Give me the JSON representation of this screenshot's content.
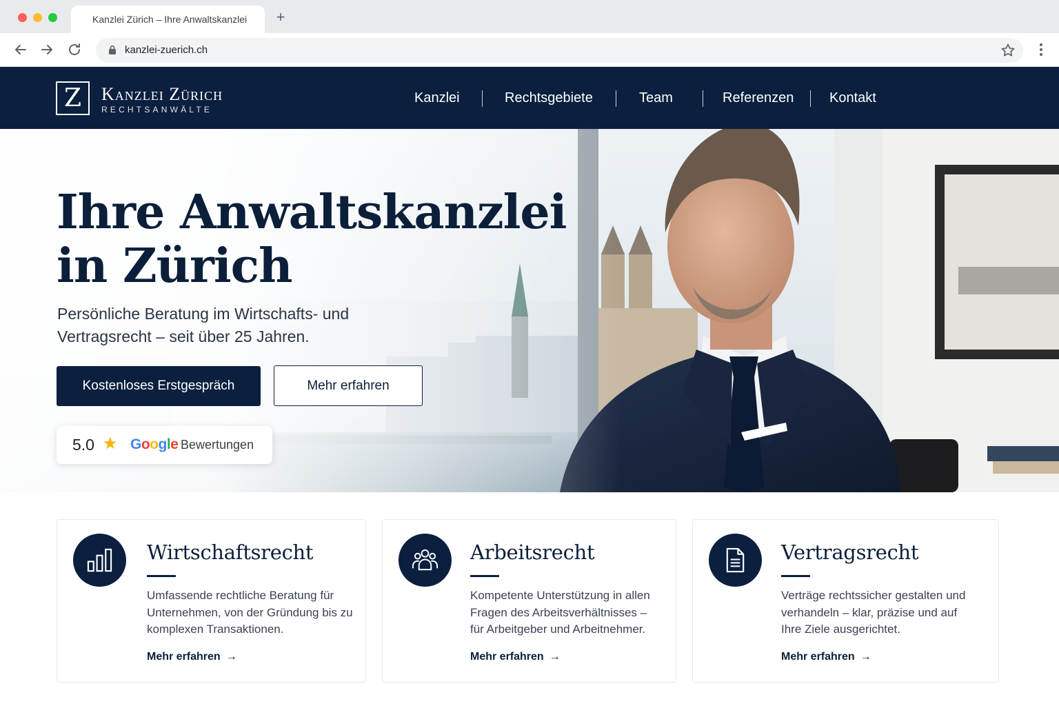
{
  "browser": {
    "tab_title": "Kanzlei Zürich – Ihre Anwaltskanzlei",
    "new_tab_icon": "plus-icon",
    "url": "kanzlei-zuerich.ch"
  },
  "site": {
    "logo_letter": "Z",
    "logo_name": "Kanzlei Zürich",
    "logo_tagline": "RECHTSANWÄLTE",
    "nav": [
      {
        "label": "Kanzlei"
      },
      {
        "label": "Rechtsgebiete"
      },
      {
        "label": "Team"
      },
      {
        "label": "Referenzen"
      },
      {
        "label": "Kontakt"
      }
    ]
  },
  "hero": {
    "title_line1": "Ihre Anwaltskanzlei",
    "title_line2": "in Zürich",
    "subtitle": "Persönliche Beratung im Wirtschafts- und Vertragsrecht – seit über 25 Jahren.",
    "primary_button": "Kostenloses Erstgespräch",
    "secondary_button": "Mehr erfahren",
    "rating": {
      "score": "5.0",
      "provider": "Google",
      "label": "Bewertungen"
    }
  },
  "cards": [
    {
      "icon": "bar-chart-icon",
      "title": "Wirtschaftsrecht",
      "text": "Umfassende rechtliche Beratung für Unternehmen, von der Gründung bis zu komplexen Transaktionen.",
      "link": "Mehr erfahren"
    },
    {
      "icon": "people-group-icon",
      "title": "Arbeitsrecht",
      "text": "Kompetente Unterstützung in allen Fragen des Arbeitsverhältnisses – für Arbeitgeber und Arbeitnehmer.",
      "link": "Mehr erfahren"
    },
    {
      "icon": "document-icon",
      "title": "Vertragsrecht",
      "text": "Verträge rechtssicher gestalten und verhandeln – klar, präzise und auf Ihre Ziele ausgerichtet.",
      "link": "Mehr erfahren"
    }
  ],
  "colors": {
    "brand_navy": "#0b1f3f",
    "star_gold": "#f5b400"
  }
}
